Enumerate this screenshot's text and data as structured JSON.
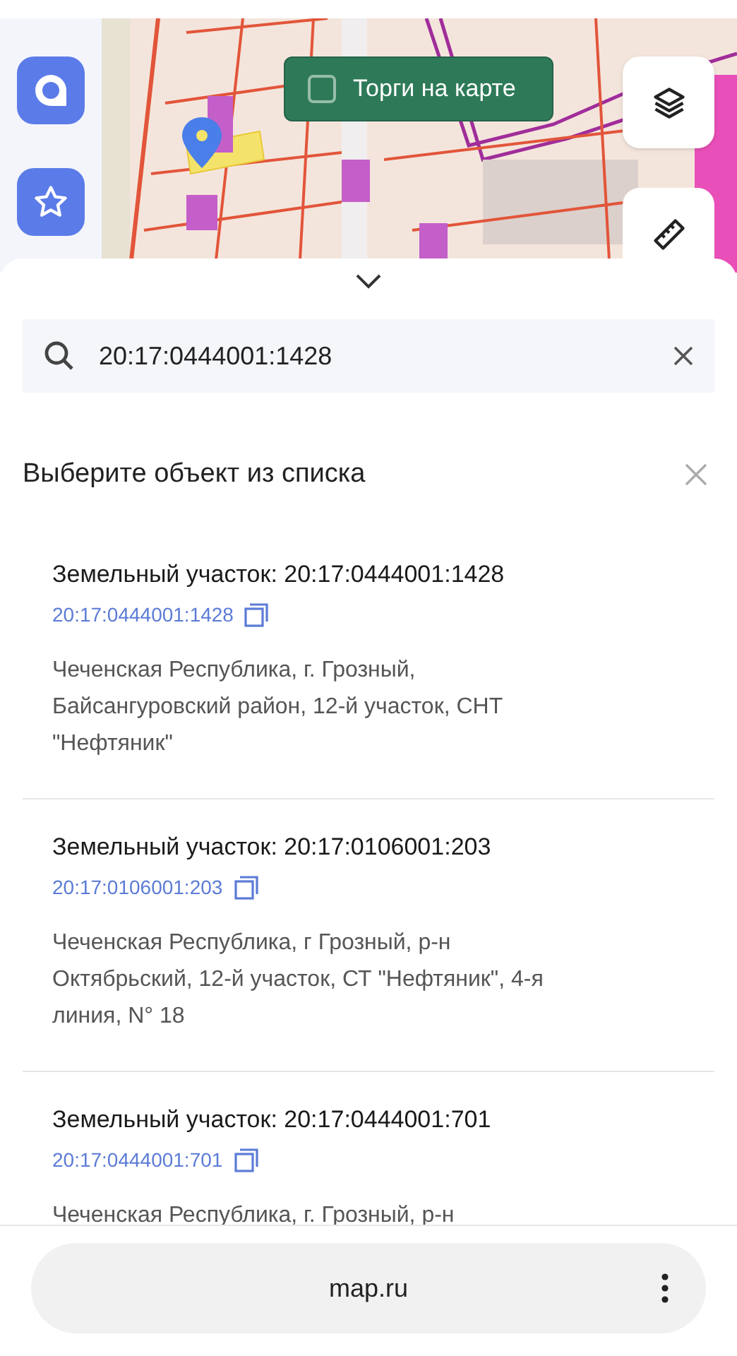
{
  "auction_toggle": {
    "label": "Торги на карте",
    "checked": false
  },
  "search": {
    "value": "20:17:0444001:1428"
  },
  "list": {
    "title": "Выберите объект из списка",
    "items": [
      {
        "title": "Земельный участок: 20:17:0444001:1428",
        "number": "20:17:0444001:1428",
        "address": "Чеченская Республика, г. Грозный, Байсангуровский район, 12-й участок, СНТ \"Нефтяник\""
      },
      {
        "title": "Земельный участок: 20:17:0106001:203",
        "number": "20:17:0106001:203",
        "address": "Чеченская Республика, г Грозный, р-н Октябрьский, 12-й участок, СТ \"Нефтяник\", 4-я линия, N° 18"
      },
      {
        "title": "Земельный участок: 20:17:0444001:701",
        "number": "20:17:0444001:701",
        "address": "Чеченская Республика, г. Грозный, р-н"
      }
    ]
  },
  "browser": {
    "url": "map.ru"
  }
}
